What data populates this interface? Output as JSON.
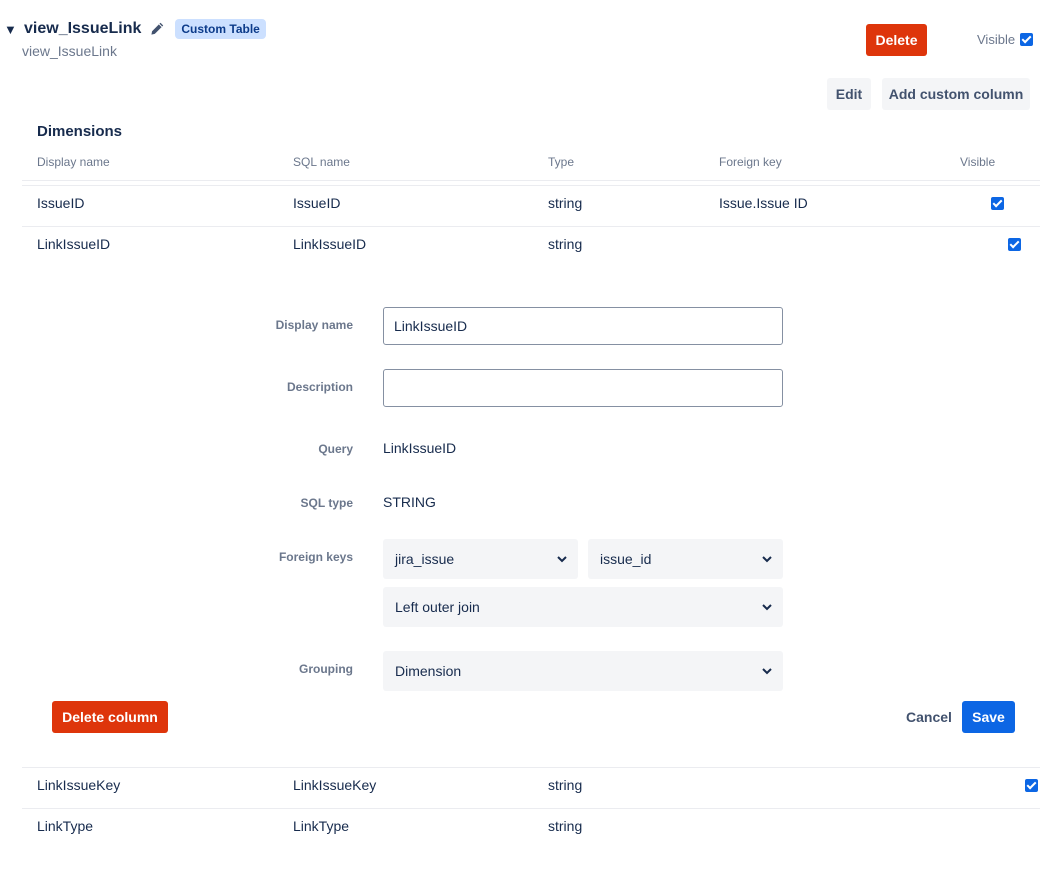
{
  "table": {
    "name": "view_IssueLink",
    "subtitle": "view_IssueLink",
    "badge": "Custom Table",
    "delete_label": "Delete",
    "visible_label": "Visible",
    "edit_label": "Edit",
    "add_column_label": "Add custom column"
  },
  "dimensions": {
    "title": "Dimensions",
    "headers": {
      "display_name": "Display name",
      "sql_name": "SQL name",
      "type": "Type",
      "foreign_key": "Foreign key",
      "visible": "Visible"
    },
    "rows": [
      {
        "display_name": "IssueID",
        "sql_name": "IssueID",
        "type": "string",
        "foreign_key": "Issue.Issue ID",
        "visible": true
      },
      {
        "display_name": "LinkIssueID",
        "sql_name": "LinkIssueID",
        "type": "string",
        "foreign_key": "",
        "visible": true
      },
      {
        "display_name": "LinkIssueKey",
        "sql_name": "LinkIssueKey",
        "type": "string",
        "foreign_key": "",
        "visible": true
      },
      {
        "display_name": "LinkType",
        "sql_name": "LinkType",
        "type": "string",
        "foreign_key": "",
        "visible": true
      }
    ]
  },
  "editor": {
    "display_name_label": "Display name",
    "display_name_value": "LinkIssueID",
    "description_label": "Description",
    "description_value": "",
    "query_label": "Query",
    "query_value": "LinkIssueID",
    "sql_type_label": "SQL type",
    "sql_type_value": "STRING",
    "foreign_keys_label": "Foreign keys",
    "fk_table": "jira_issue",
    "fk_column": "issue_id",
    "join_type": "Left outer join",
    "grouping_label": "Grouping",
    "grouping_value": "Dimension",
    "delete_column_label": "Delete column",
    "cancel_label": "Cancel",
    "save_label": "Save"
  },
  "colors": {
    "danger": "#de350b",
    "primary": "#0c66e4",
    "text": "#172b4d",
    "muted": "#6b778c"
  }
}
